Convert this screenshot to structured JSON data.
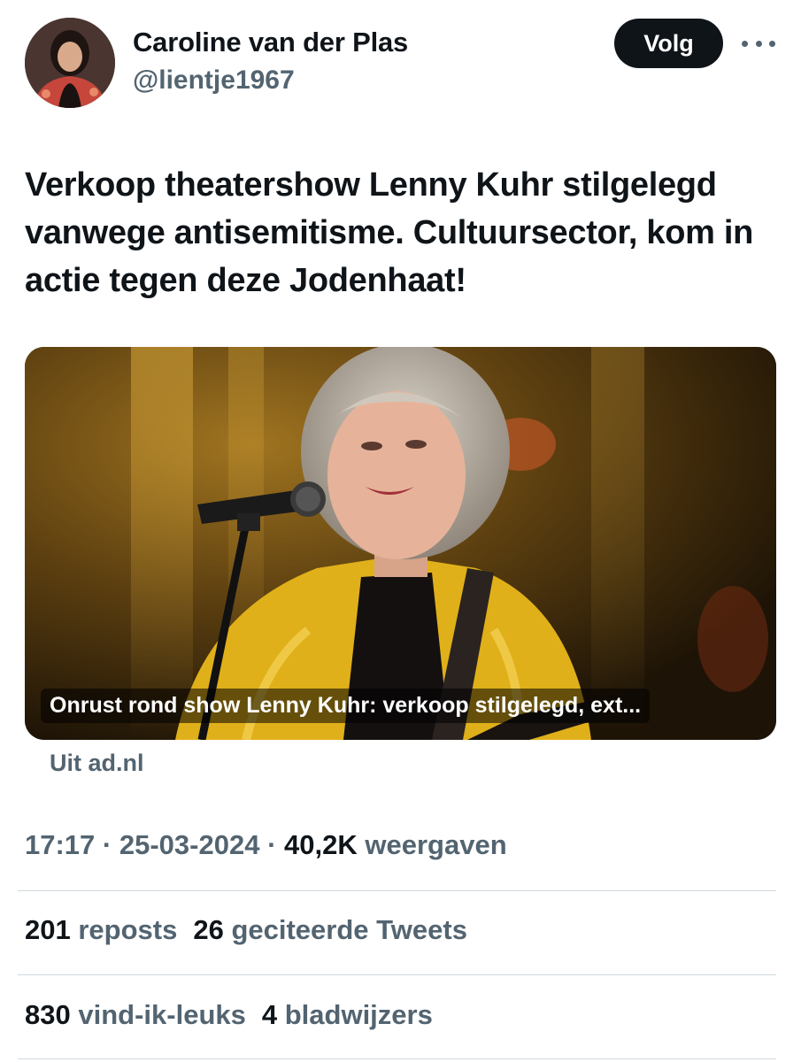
{
  "author": {
    "display_name": "Caroline van der Plas",
    "handle": "@lientje1967"
  },
  "header": {
    "follow_label": "Volg"
  },
  "tweet": {
    "text": "Verkoop theatershow Lenny Kuhr stilgelegd vanwege antisemitisme. Cultuursector, kom in actie tegen deze Jodenhaat!"
  },
  "card": {
    "headline": "Onrust rond show Lenny Kuhr: verkoop stilgelegd, ext...",
    "source": "Uit ad.nl"
  },
  "meta": {
    "time": "17:17",
    "separator": "·",
    "date": "25-03-2024",
    "views_count": "40,2K",
    "views_label": "weergaven"
  },
  "stats": {
    "reposts_count": "201",
    "reposts_label": "reposts",
    "quotes_count": "26",
    "quotes_label": "geciteerde Tweets",
    "likes_count": "830",
    "likes_label": "vind-ik-leuks",
    "bookmarks_count": "4",
    "bookmarks_label": "bladwijzers"
  },
  "colors": {
    "text_primary": "#0f1419",
    "text_secondary": "#536471",
    "divider": "#cfd9de",
    "button_bg": "#0f1419",
    "jacket_yellow": "#e8b81a"
  }
}
